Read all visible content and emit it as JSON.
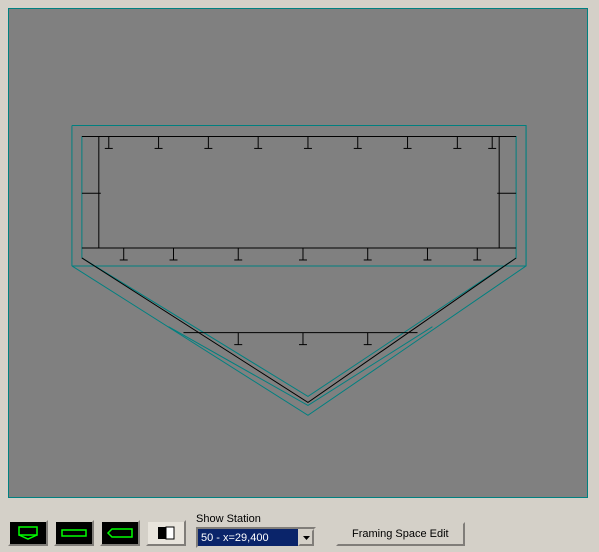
{
  "viewport": {
    "bg": "#808080",
    "stroke_outline": "#008080",
    "stroke_structure": "#000000"
  },
  "toolbar": {
    "icons": {
      "view_front": "view-front",
      "view_side": "view-side",
      "view_top": "view-top",
      "view_mode": "view-mode"
    },
    "station_label": "Show Station",
    "station_value": "50 - x=29,400",
    "framing_edit_label": "Framing Space Edit"
  }
}
